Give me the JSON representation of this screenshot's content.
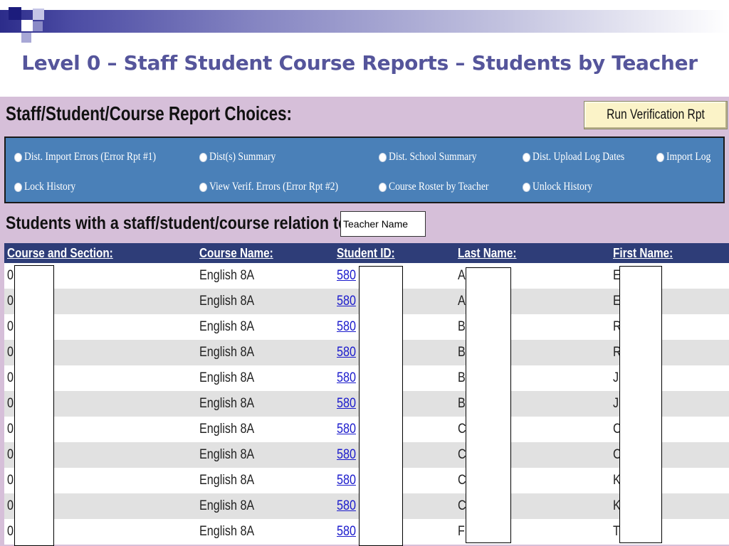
{
  "slide": {
    "title": "Level 0 – Staff Student Course Reports – Students by Teacher"
  },
  "report": {
    "heading": "Staff/Student/Course Report Choices:",
    "run_button_label": "Run Verification Rpt",
    "choices": [
      {
        "label": "Dist. Import Errors (Error Rpt #1)"
      },
      {
        "label": "Dist(s) Summary"
      },
      {
        "label": "Dist. School Summary"
      },
      {
        "label": "Dist. Upload Log Dates"
      },
      {
        "label": "Import Log"
      },
      {
        "label": "Lock History"
      },
      {
        "label": "View Verif. Errors (Error Rpt #2)"
      },
      {
        "label": "Course Roster by Teacher"
      },
      {
        "label": "Unlock History"
      }
    ],
    "relation_label": "Students with a staff/student/course relation to -",
    "teacher_input_value": "Teacher Name"
  },
  "table": {
    "headers": [
      "Course and Section:",
      "Course Name:",
      "Student ID:",
      "Last Name:",
      "First Name:"
    ],
    "rows": [
      {
        "section": "0",
        "course": "English 8A",
        "student_id": "580",
        "last": "A",
        "first": "E"
      },
      {
        "section": "0",
        "course": "English 8A",
        "student_id": "580",
        "last": "A",
        "first": "E"
      },
      {
        "section": "0",
        "course": "English 8A",
        "student_id": "580",
        "last": "B",
        "first": "R"
      },
      {
        "section": "0",
        "course": "English 8A",
        "student_id": "580",
        "last": "B",
        "first": "R"
      },
      {
        "section": "0",
        "course": "English 8A",
        "student_id": "580",
        "last": "B",
        "first": "J"
      },
      {
        "section": "0",
        "course": "English 8A",
        "student_id": "580",
        "last": "B",
        "first": "J"
      },
      {
        "section": "0",
        "course": "English 8A",
        "student_id": "580",
        "last": "C",
        "first": "C"
      },
      {
        "section": "0",
        "course": "English 8A",
        "student_id": "580",
        "last": "C",
        "first": "C"
      },
      {
        "section": "0",
        "course": "English 8A",
        "student_id": "580",
        "last": "C",
        "first": "K"
      },
      {
        "section": "0",
        "course": "English 8A",
        "student_id": "580",
        "last": "C",
        "first": "K"
      },
      {
        "section": "0",
        "course": "English 8A",
        "student_id": "580",
        "last": "F",
        "first": "T"
      }
    ]
  },
  "colors": {
    "slide_title": "#55559b",
    "app_background": "#d6bfd9",
    "choices_panel": "#4a80b8",
    "table_header": "#2e3d78",
    "row_alt": "#e1e1e1",
    "button": "#fbf3c8",
    "link": "#1a1acc"
  }
}
